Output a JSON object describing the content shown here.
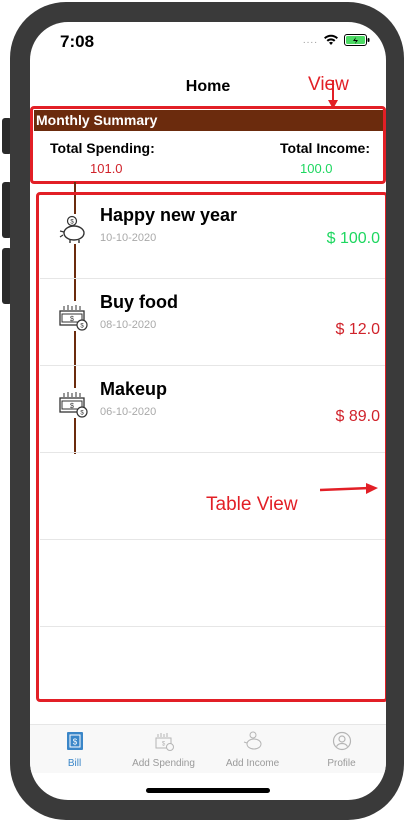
{
  "status": {
    "time": "7:08"
  },
  "nav": {
    "title": "Home"
  },
  "annotations": {
    "view": "View",
    "table_view": "Table View"
  },
  "summary": {
    "heading": "Monthly Summary",
    "spending_label": "Total Spending:",
    "spending_value": "101.0",
    "income_label": "Total Income:",
    "income_value": "100.0"
  },
  "transactions": [
    {
      "title": "Happy new year",
      "date": "10-10-2020",
      "amount": "$ 100.0",
      "type": "income",
      "icon": "piggy-bank-icon"
    },
    {
      "title": "Buy food",
      "date": "08-10-2020",
      "amount": "$ 12.0",
      "type": "spending",
      "icon": "money-stack-icon"
    },
    {
      "title": "Makeup",
      "date": "06-10-2020",
      "amount": "$ 89.0",
      "type": "spending",
      "icon": "money-stack-icon"
    }
  ],
  "tabs": [
    {
      "label": "Bill",
      "icon": "bill-icon",
      "active": true
    },
    {
      "label": "Add Spending",
      "icon": "money-stack-icon",
      "active": false
    },
    {
      "label": "Add Income",
      "icon": "piggy-bank-icon",
      "active": false
    },
    {
      "label": "Profile",
      "icon": "profile-icon",
      "active": false
    }
  ],
  "colors": {
    "brown": "#6b2b0d",
    "annotation_red": "#e21f26",
    "income_green": "#1ed760",
    "spending_red": "#d0232b",
    "tab_active": "#3a86c8",
    "tab_inactive": "#9a9a9a"
  }
}
